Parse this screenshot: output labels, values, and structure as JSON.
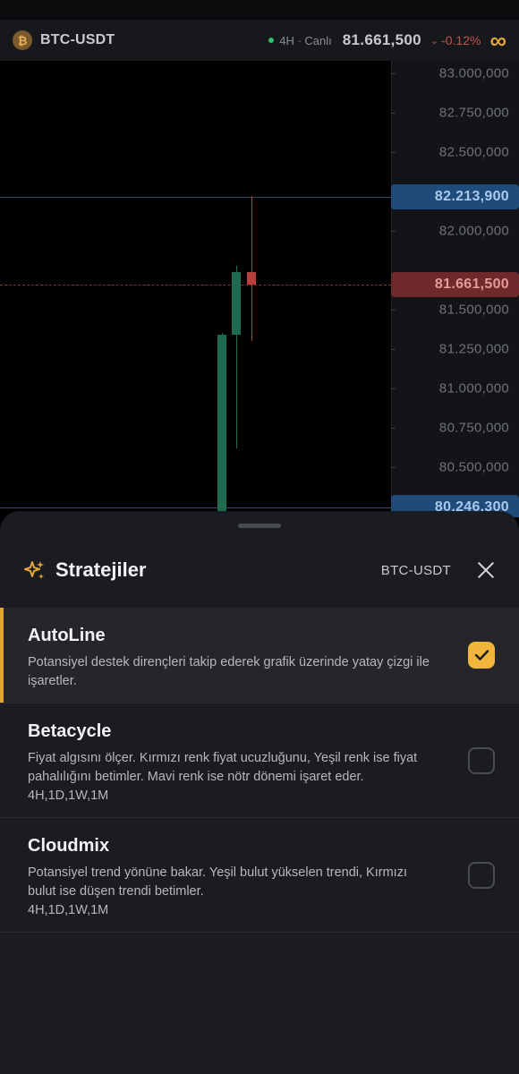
{
  "header": {
    "pair": "BTC-USDT",
    "coin_symbol": "₿",
    "timeframe": "4H · Canlı",
    "price": "81.661,500",
    "change": "-0.12%",
    "change_arrow": "⌄"
  },
  "chart": {
    "axis_labels": [
      "83.000,000",
      "82.750,000",
      "82.500,000",
      "82.000,000",
      "81.500,000",
      "81.250,000",
      "81.000,000",
      "80.750,000",
      "80.500,000"
    ],
    "levels": [
      {
        "label": "82.213,900",
        "value": 82213.9,
        "color": "blue"
      },
      {
        "label": "81.661,500",
        "value": 81661.5,
        "color": "red"
      },
      {
        "label": "80.246,300",
        "value": 80246.3,
        "color": "blue"
      }
    ],
    "candles": [
      {
        "open": 80200,
        "close": 81340,
        "high": 81350,
        "low": 80100,
        "color": "#1f6b4f"
      },
      {
        "open": 81340,
        "close": 81740,
        "high": 81780,
        "low": 80620,
        "color": "#1f6b4f"
      },
      {
        "open": 81740,
        "close": 81661.5,
        "high": 82220,
        "low": 81300,
        "color": "#b8403c"
      }
    ]
  },
  "sheet": {
    "title": "Stratejiler",
    "pair": "BTC-USDT",
    "strategies": [
      {
        "name": "AutoLine",
        "description": "Potansiyel destek dirençleri takip ederek grafik üzerinde yatay çizgi ile işaretler.",
        "timeframes": "",
        "checked": true
      },
      {
        "name": "Betacycle",
        "description": "Fiyat algısını ölçer. Kırmızı renk fiyat ucuzluğunu, Yeşil renk ise fiyat pahalılığını betimler. Mavi renk ise nötr dönemi işaret eder.",
        "timeframes": "4H,1D,1W,1M",
        "checked": false
      },
      {
        "name": "Cloudmix",
        "description": "Potansiyel trend yönüne bakar. Yeşil bulut yükselen trendi, Kırmızı bulut ise düşen trendi betimler.",
        "timeframes": "4H,1D,1W,1M",
        "checked": false
      }
    ]
  },
  "icons": {
    "coin": "bitcoin-icon",
    "brand": "infinity-icon",
    "strategies": "sparkle-icon",
    "close": "close-icon",
    "check": "check-icon"
  },
  "colors": {
    "accent": "#f0b63c",
    "up": "#1f6b4f",
    "down": "#b8403c",
    "level_blue": "#1f4b7a",
    "level_red": "#6e2a2a"
  }
}
